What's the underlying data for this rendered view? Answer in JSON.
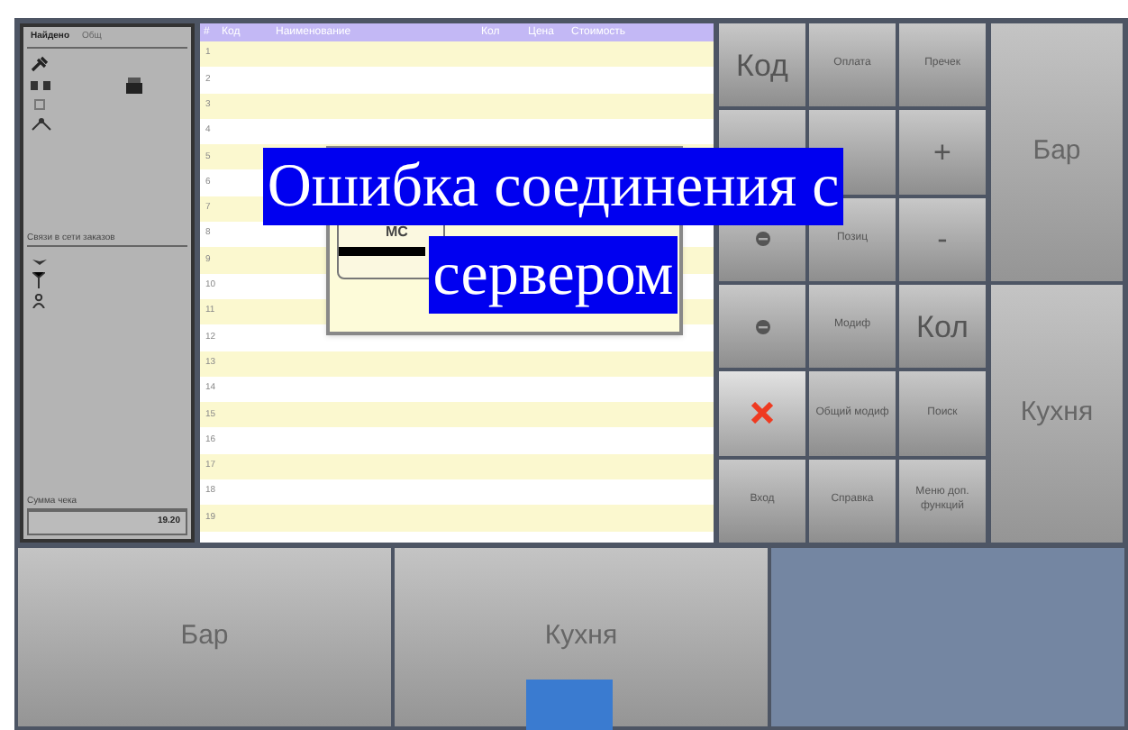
{
  "left_panel": {
    "tabs": [
      {
        "label": "Найдено",
        "selected": true
      },
      {
        "label": "Общ",
        "selected": false
      }
    ],
    "section_label": "Связи в сети заказов",
    "total_label": "Сумма чека",
    "total_value": "19.20"
  },
  "order_table": {
    "columns": [
      "#",
      "Код",
      "Наименование",
      "Кол",
      "Цена",
      "Стоимость"
    ],
    "rows": [
      "1",
      "2",
      "3",
      "4",
      "5",
      "6",
      "7",
      "8",
      "9",
      "10",
      "11",
      "12",
      "13",
      "14",
      "15",
      "16",
      "17",
      "18",
      "19"
    ]
  },
  "dialog": {
    "label": "МС"
  },
  "error_message": [
    "Ошибка соединения с",
    "сервером"
  ],
  "keypad": [
    {
      "kind": "text",
      "label": "Код",
      "large": true
    },
    {
      "kind": "text",
      "label": "Оплата",
      "large": false
    },
    {
      "kind": "text",
      "label": "Пречек",
      "large": false
    },
    {
      "kind": "blank"
    },
    {
      "kind": "blank"
    },
    {
      "kind": "text",
      "label": "+",
      "large": true
    },
    {
      "kind": "circle"
    },
    {
      "kind": "text",
      "label": "Позиц",
      "large": false
    },
    {
      "kind": "text",
      "label": "-",
      "large": true
    },
    {
      "kind": "circle"
    },
    {
      "kind": "text",
      "label": "Модиф",
      "large": false
    },
    {
      "kind": "text",
      "label": "Кол",
      "large": true
    },
    {
      "kind": "cancel"
    },
    {
      "kind": "text",
      "label": "Общий модиф",
      "large": false
    },
    {
      "kind": "text",
      "label": "Поиск",
      "large": false
    },
    {
      "kind": "text",
      "label": "Вход",
      "large": false
    },
    {
      "kind": "text",
      "label": "Справка",
      "large": false
    },
    {
      "kind": "text",
      "label": "Меню доп. функций",
      "large": false
    }
  ],
  "side_buttons": [
    "Бар",
    "Кухня"
  ],
  "bottom_buttons": [
    "Бар",
    "Кухня"
  ]
}
